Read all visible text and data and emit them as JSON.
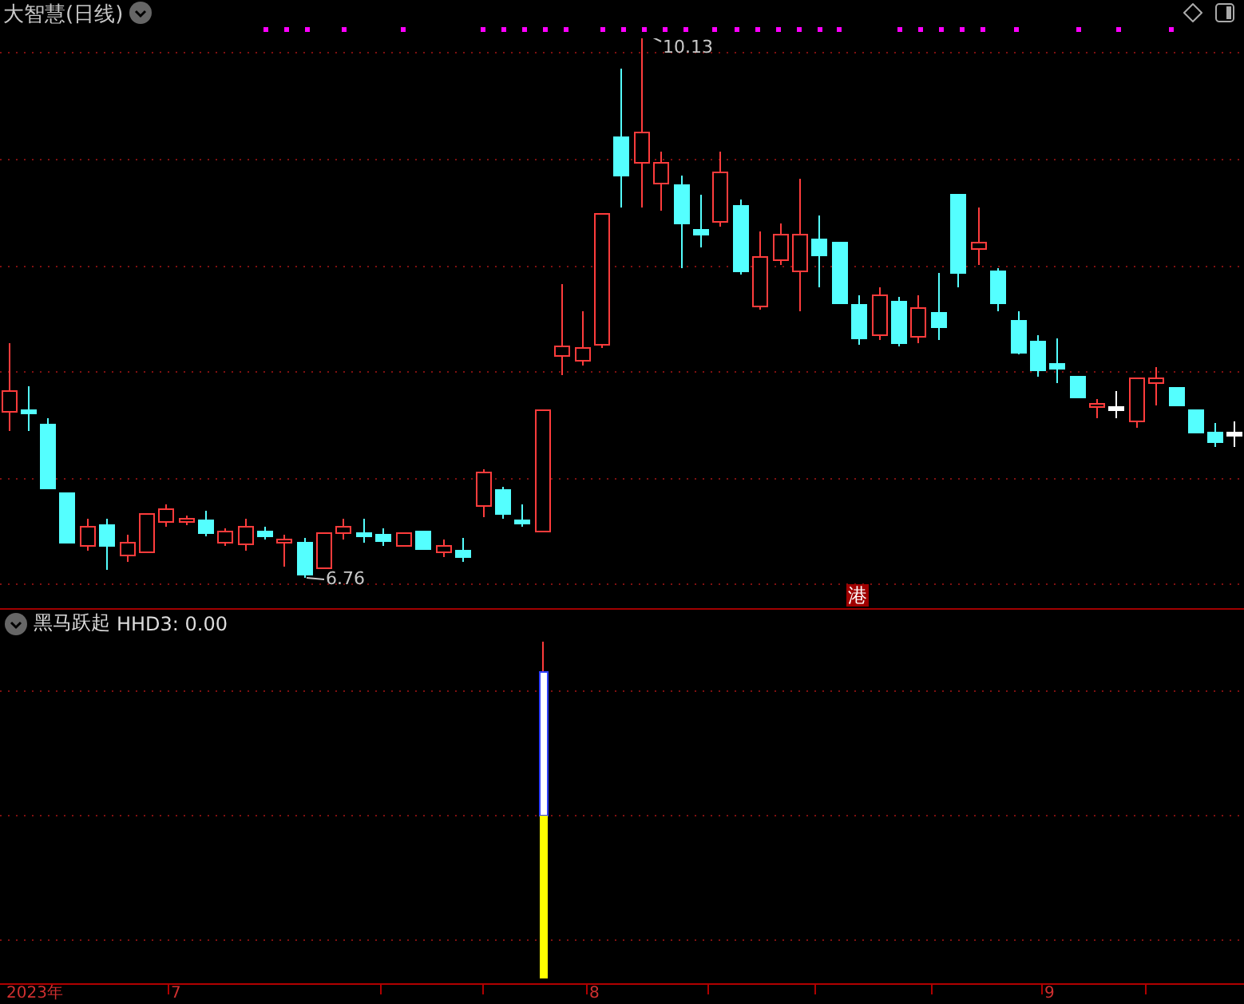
{
  "chart": {
    "title": "大智慧(日线)",
    "high_label": "10.13",
    "low_label": "6.76",
    "marker": "港"
  },
  "indicator": {
    "name": "黑马跃起",
    "reading": "HHD3: 0.00"
  },
  "axis": {
    "labels": [
      "2023年",
      "7",
      "8",
      "9"
    ]
  }
}
